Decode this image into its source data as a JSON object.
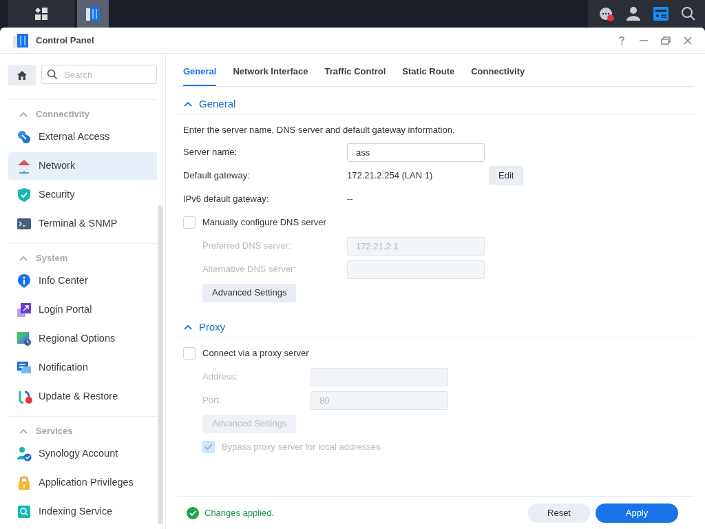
{
  "taskbar": {
    "apps": [
      {
        "selected": false
      },
      {
        "selected": true
      }
    ],
    "tray": [
      {
        "selected": false,
        "badge": true
      },
      {
        "selected": false
      },
      {
        "selected": true
      },
      {
        "selected": false
      }
    ]
  },
  "window": {
    "title": "Control Panel"
  },
  "search": {
    "placeholder": "Search"
  },
  "sidebar": {
    "groups": [
      {
        "title": "Connectivity",
        "expanded": true,
        "items": [
          {
            "label": "External Access",
            "selected": false
          },
          {
            "label": "Network",
            "selected": true
          },
          {
            "label": "Security",
            "selected": false
          },
          {
            "label": "Terminal & SNMP",
            "selected": false
          }
        ]
      },
      {
        "title": "System",
        "expanded": true,
        "items": [
          {
            "label": "Info Center",
            "selected": false
          },
          {
            "label": "Login Portal",
            "selected": false
          },
          {
            "label": "Regional Options",
            "selected": false
          },
          {
            "label": "Notification",
            "selected": false
          },
          {
            "label": "Update & Restore",
            "selected": false,
            "badge": true
          }
        ]
      },
      {
        "title": "Services",
        "expanded": true,
        "items": [
          {
            "label": "Synology Account",
            "selected": false
          },
          {
            "label": "Application Privileges",
            "selected": false
          },
          {
            "label": "Indexing Service",
            "selected": false
          }
        ]
      }
    ]
  },
  "tabs": [
    {
      "label": "General",
      "selected": true
    },
    {
      "label": "Network Interface",
      "selected": false
    },
    {
      "label": "Traffic Control",
      "selected": false
    },
    {
      "label": "Static Route",
      "selected": false
    },
    {
      "label": "Connectivity",
      "selected": false
    }
  ],
  "general": {
    "title": "General",
    "expanded": true,
    "intro": "Enter the server name, DNS server and default gateway information.",
    "server_name": {
      "label": "Server name:",
      "value": "ass"
    },
    "default_gateway": {
      "label": "Default gateway:",
      "value": "172.21.2.254 (LAN 1)",
      "button": "Edit"
    },
    "ipv6_gateway": {
      "label": "IPv6 default gateway:",
      "value": "--"
    },
    "manual_dns": {
      "label": "Manually configure DNS server",
      "checked": false
    },
    "preferred_dns": {
      "label": "Preferred DNS server:",
      "value": "172.21.2.1",
      "disabled": true
    },
    "alternative_dns": {
      "label": "Alternative DNS server:",
      "disabled": true
    },
    "advanced": {
      "label": "Advanced Settings",
      "disabled": false
    }
  },
  "proxy": {
    "title": "Proxy",
    "expanded": true,
    "connect": {
      "label": "Connect via a proxy server",
      "checked": false
    },
    "address": {
      "label": "Address:",
      "disabled": true
    },
    "port": {
      "label": "Port:",
      "value": "80",
      "disabled": true
    },
    "advanced": {
      "label": "Advanced Settings",
      "disabled": true
    },
    "bypass": {
      "label": "Bypass proxy server for local addresses",
      "checked": true,
      "disabled": true
    }
  },
  "footer": {
    "status": "Changes applied.",
    "buttons": [
      {
        "label": "Reset",
        "kind": "secondary"
      },
      {
        "label": "Apply",
        "kind": "primary"
      }
    ]
  }
}
